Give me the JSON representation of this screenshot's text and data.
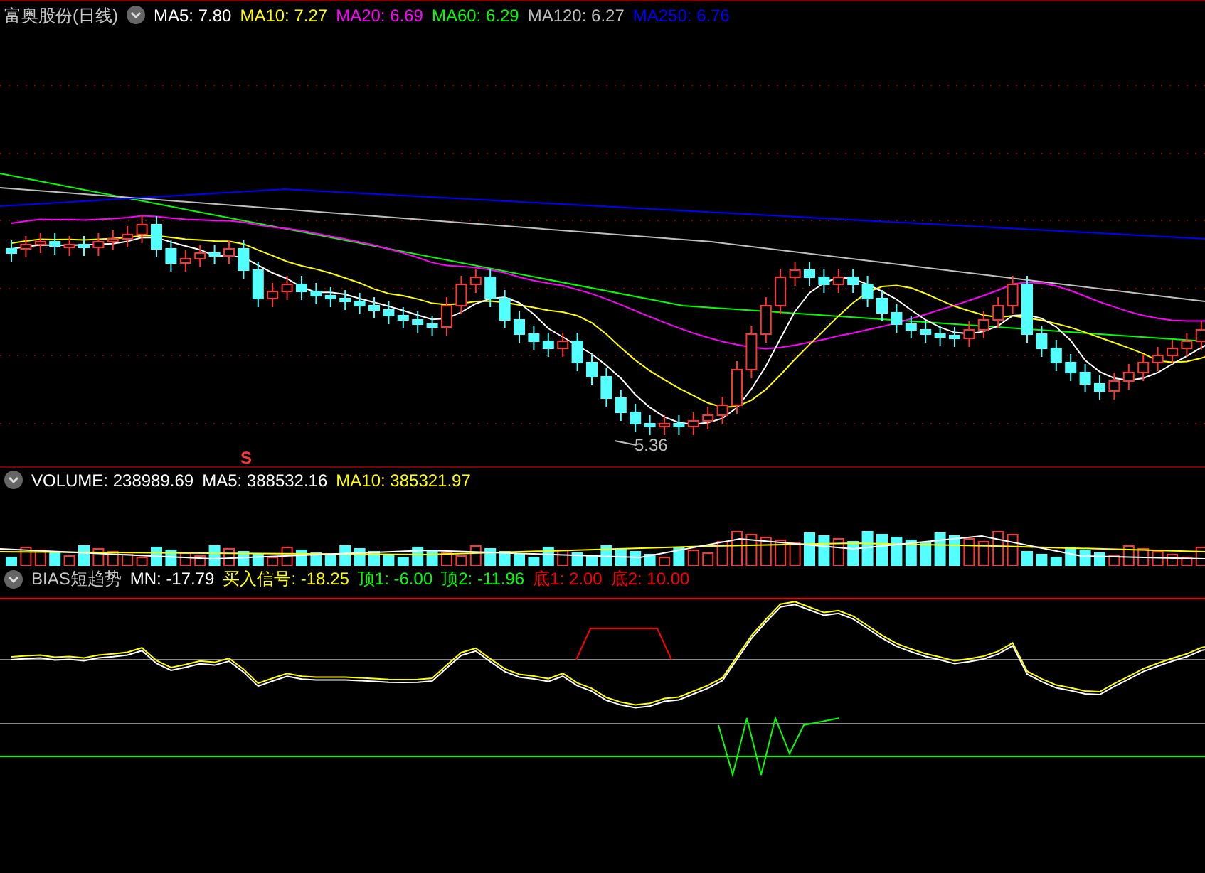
{
  "price_panel": {
    "title": "富奥股份(日线)",
    "indicators": [
      {
        "label": "MA5: 7.80",
        "color": "#ffffff"
      },
      {
        "label": "MA10: 7.27",
        "color": "#ffff00"
      },
      {
        "label": "MA20: 6.69",
        "color": "#ff00ff"
      },
      {
        "label": "MA60: 6.29",
        "color": "#00ff00"
      },
      {
        "label": "MA120: 6.27",
        "color": "#c0c0c0"
      },
      {
        "label": "MA250: 6.76",
        "color": "#0000ff"
      }
    ],
    "low_label": "5.36",
    "signal_mark": "S"
  },
  "volume_panel": {
    "indicators": [
      {
        "label": "VOLUME: 238989.69",
        "color": "#ffffff"
      },
      {
        "label": "MA5: 388532.16",
        "color": "#ffffff"
      },
      {
        "label": "MA10: 385321.97",
        "color": "#ffff00"
      }
    ]
  },
  "bias_panel": {
    "title": "BIAS短趋势",
    "indicators": [
      {
        "label": "MN: -17.79",
        "color": "#ffffff"
      },
      {
        "label": "买入信号: -18.25",
        "color": "#ffff00"
      },
      {
        "label": "顶1: -6.00",
        "color": "#00ff00"
      },
      {
        "label": "顶2: -11.96",
        "color": "#00ff00"
      },
      {
        "label": "底1: 2.00",
        "color": "#ff0000"
      },
      {
        "label": "底2: 10.00",
        "color": "#ff0000"
      }
    ]
  }
}
